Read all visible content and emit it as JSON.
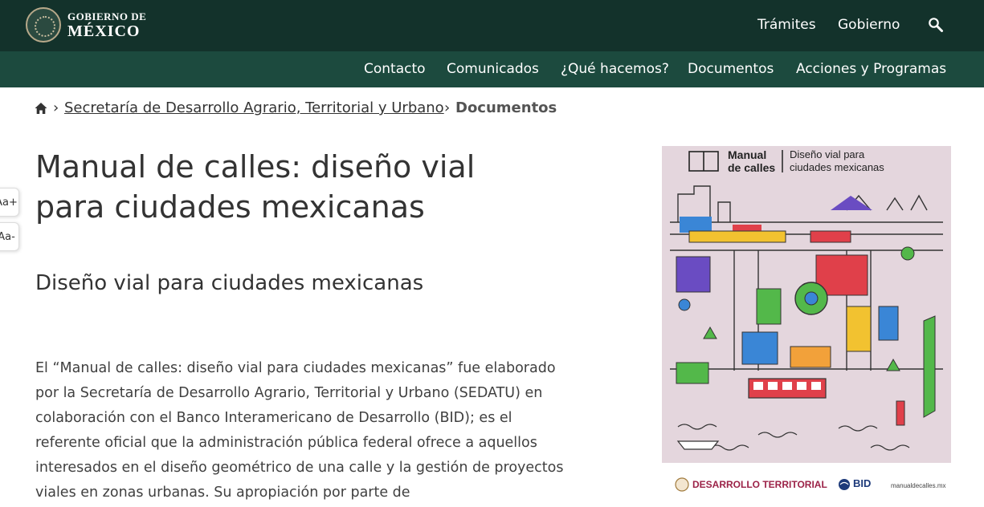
{
  "header": {
    "logo_line1": "GOBIERNO DE",
    "logo_line2": "MÉXICO",
    "links": [
      "Trámites",
      "Gobierno"
    ],
    "search_icon": "search-icon"
  },
  "nav": {
    "items": [
      "Contacto",
      "Comunicados",
      "¿Qué hacemos?",
      "Documentos",
      "Acciones y Programas"
    ]
  },
  "breadcrumb": {
    "home_icon": "home-icon",
    "separator": "›",
    "parent": "Secretaría de Desarrollo Agrario, Territorial y Urbano",
    "current": "Documentos"
  },
  "font_controls": {
    "increase": "Aa+",
    "decrease": "Aa-"
  },
  "article": {
    "title": "Manual de calles: diseño vial para ciudades mexicanas",
    "subtitle": "Diseño vial para ciudades mexicanas",
    "body": "El “Manual de calles: diseño vial para ciudades mexicanas” fue elaborado por la Secretaría de Desarrollo Agrario, Territorial y Urbano (SEDATU) en colaboración con el Banco Interamericano de Desarrollo (BID); es el referente oficial que la administración pública federal ofrece a aquellos interesados en el diseño geométrico de una calle y la gestión de proyectos viales en zonas urbanas. Su apropiación por parte de"
  },
  "cover": {
    "title_line1": "Manual",
    "title_line2": "de calles",
    "subtitle_line1": "Diseño vial para",
    "subtitle_line2": "ciudades mexicanas",
    "footer_org": "DESARROLLO TERRITORIAL",
    "footer_bid": "BID",
    "footer_url": "manualdecalles.mx",
    "colors": {
      "background": "#e4d6dd",
      "accent_red": "#e0404a",
      "accent_blue": "#3a86d6",
      "accent_green": "#53b84a",
      "accent_yellow": "#f2c230",
      "accent_purple": "#6a4cc2"
    }
  }
}
